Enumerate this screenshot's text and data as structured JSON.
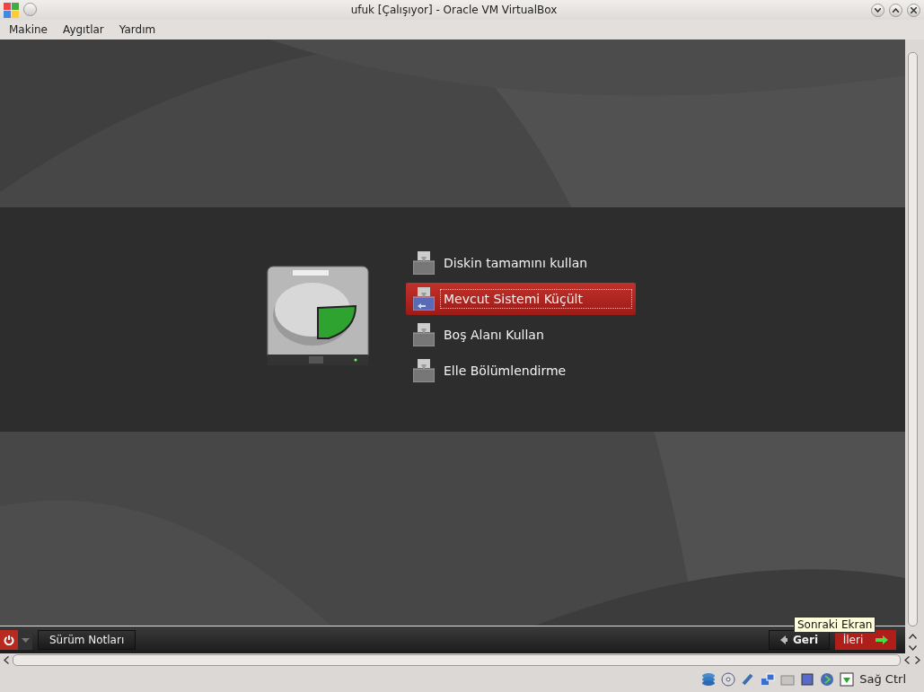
{
  "window": {
    "title": "ufuk [Çalışıyor] - Oracle VM VirtualBox"
  },
  "menu": [
    "Makine",
    "Aygıtlar",
    "Yardım"
  ],
  "options": [
    {
      "label": "Diskin tamamını kullan",
      "selected": false
    },
    {
      "label": "Mevcut Sistemi Küçült",
      "selected": true
    },
    {
      "label": "Boş Alanı Kullan",
      "selected": false
    },
    {
      "label": "Elle Bölümlendirme",
      "selected": false
    }
  ],
  "bottom_bar": {
    "notes_button": "Sürüm Notları",
    "back_button": "Geri",
    "next_button": "İleri",
    "tooltip": "Sonraki Ekran"
  },
  "status_bar": {
    "host_key": "Sağ Ctrl"
  }
}
